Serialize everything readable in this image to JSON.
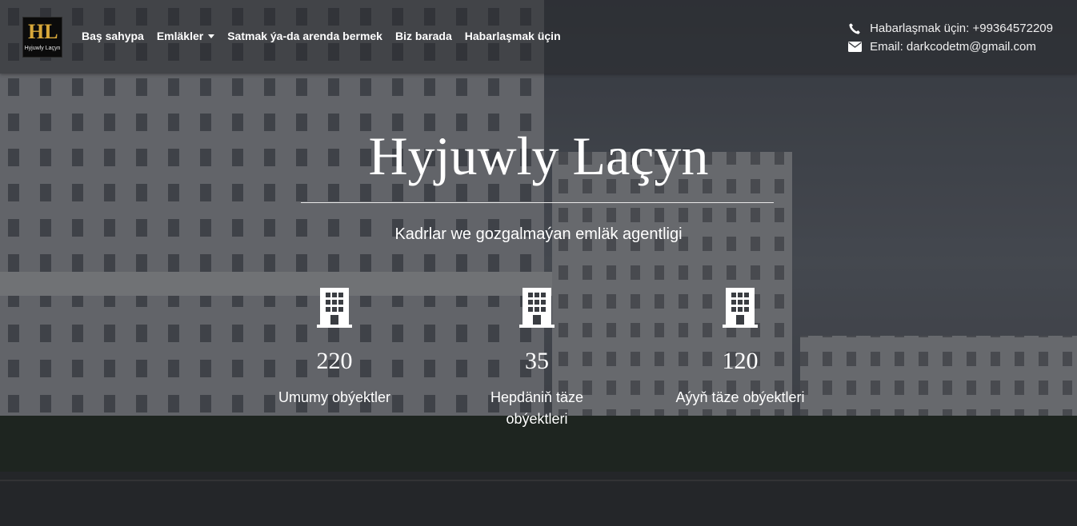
{
  "nav": {
    "logo_text": "Hyjuwly Laçyn",
    "logo_mark": "HL",
    "items": [
      {
        "label": "Baş sahypa"
      },
      {
        "label": "Emläkler"
      },
      {
        "label": "Satmak ýa-da arenda bermek"
      },
      {
        "label": "Biz barada"
      },
      {
        "label": "Habarlaşmak üçin"
      }
    ]
  },
  "contact": {
    "phone": "Habarlaşmak üçin: +99364572209",
    "email": "Email: darkcodetm@gmail.com",
    "phone_icon": "phone-icon",
    "email_icon": "envelope-icon"
  },
  "hero": {
    "title": "Hyjuwly Laçyn",
    "subtitle": "Kadrlar we gozgalmaýan emläk agentligi"
  },
  "stats": [
    {
      "icon": "building-icon",
      "value": "220",
      "label": "Umumy obýektler"
    },
    {
      "icon": "building-icon",
      "value": "35",
      "label": "Hepdäniň täze obýektleri"
    },
    {
      "icon": "building-icon",
      "value": "120",
      "label": "Aýyň täze obýektleri"
    }
  ],
  "colors": {
    "text": "#ffffff",
    "logo_gold": "#d8a83a"
  }
}
